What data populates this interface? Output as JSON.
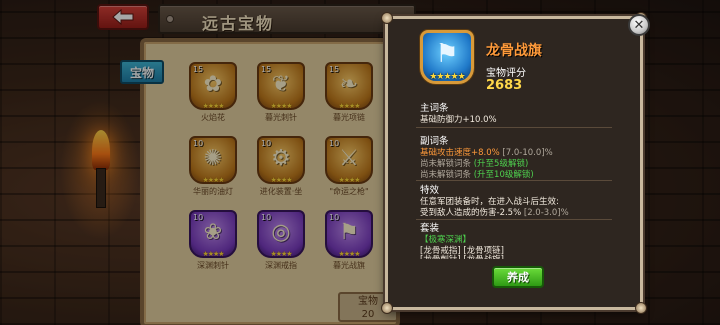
{
  "header": {
    "title": "远古宝物",
    "back_icon": "back-arrow-icon"
  },
  "sidebar": {
    "tab_label": "宝物"
  },
  "grid": {
    "items": [
      {
        "level": "15",
        "name": "火焰花",
        "glyph": "✿",
        "stars": "★★★★",
        "rarity": "gold"
      },
      {
        "level": "15",
        "name": "暮光刺针",
        "glyph": "❦",
        "stars": "★★★★",
        "rarity": "gold"
      },
      {
        "level": "15",
        "name": "暮光项链",
        "glyph": "❧",
        "stars": "★★★★",
        "rarity": "gold"
      },
      {
        "level": "10",
        "name": "华丽的油灯",
        "glyph": "✺",
        "stars": "★★★★",
        "rarity": "gold"
      },
      {
        "level": "10",
        "name": "进化装置·坐",
        "glyph": "⚙",
        "stars": "★★★★",
        "rarity": "gold"
      },
      {
        "level": "10",
        "name": "\"命运之枪\"",
        "glyph": "⚔",
        "stars": "★★★★",
        "rarity": "gold"
      },
      {
        "level": "10",
        "name": "深渊刺针",
        "glyph": "❀",
        "stars": "★★★★",
        "rarity": "purple"
      },
      {
        "level": "10",
        "name": "深渊戒指",
        "glyph": "◎",
        "stars": "★★★★",
        "rarity": "purple"
      },
      {
        "level": "10",
        "name": "暮光战旗",
        "glyph": "⚑",
        "stars": "★★★★",
        "rarity": "purple"
      }
    ]
  },
  "bottom": {
    "line1": "宝物",
    "line2": "20"
  },
  "detail": {
    "name": "龙骨战旗",
    "stars": "★★★★★",
    "score_label": "宝物评分",
    "score_value": "2683",
    "main_attr_heading": "主词条",
    "main_attr": "基础防御力+10.0%",
    "sub_attr_heading": "副词条",
    "sub_attr_value": "基础攻击速度+8.0%",
    "sub_attr_range": "[7.0-10.0]%",
    "locked_1": "尚未解锁词条",
    "locked_1_hint": "(升至5级解锁)",
    "locked_2": "尚未解锁词条",
    "locked_2_hint": "(升至10级解锁)",
    "effect_heading": "特效",
    "effect_line1": "任意军团装备时，在进入战斗后生效:",
    "effect_line2": "受到敌人造成的伤害-2.5%",
    "effect_range": "[2.0-3.0]%",
    "set_heading": "套装",
    "set_name": "【极寒深渊】",
    "set_pieces": "[龙骨戒指] [龙骨项链]",
    "set_pieces_2": "[龙骨刺针] [龙骨战旗]",
    "confirm_label": "养成",
    "close_label": "✕"
  },
  "colors": {
    "title_orange": "#ff9a3a",
    "score_yellow": "#ffd84a",
    "unlock_green": "#4ed04e",
    "confirm_green": "#2e9a14"
  }
}
